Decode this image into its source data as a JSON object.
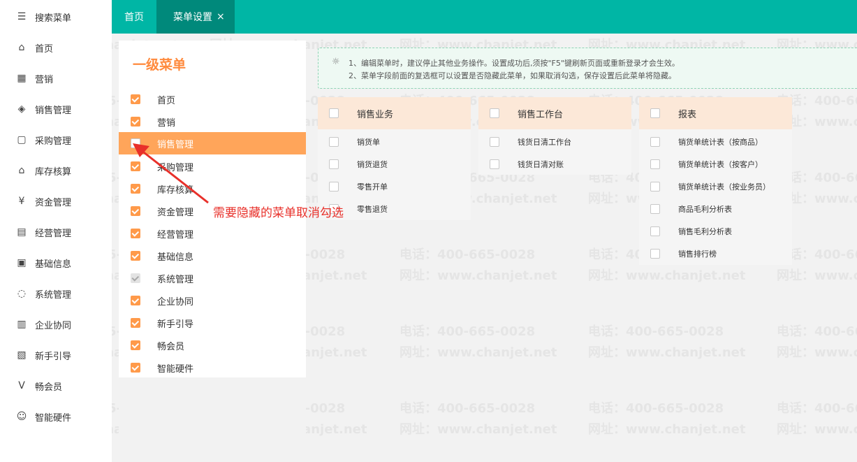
{
  "nav": {
    "items": [
      {
        "label": "搜索菜单",
        "icon": "search-menu-icon",
        "glyph": "☰"
      },
      {
        "label": "首页",
        "icon": "home-icon",
        "glyph": "⌂"
      },
      {
        "label": "营销",
        "icon": "gift-icon",
        "glyph": "▦"
      },
      {
        "label": "销售管理",
        "icon": "sales-icon",
        "glyph": "◈"
      },
      {
        "label": "采购管理",
        "icon": "purchase-bag-icon",
        "glyph": "▢"
      },
      {
        "label": "库存核算",
        "icon": "warehouse-icon",
        "glyph": "⌂"
      },
      {
        "label": "资金管理",
        "icon": "money-icon",
        "glyph": "¥"
      },
      {
        "label": "经营管理",
        "icon": "clipboard-icon",
        "glyph": "▤"
      },
      {
        "label": "基础信息",
        "icon": "id-card-icon",
        "glyph": "▣"
      },
      {
        "label": "系统管理",
        "icon": "system-cycle-icon",
        "glyph": "◌"
      },
      {
        "label": "企业协同",
        "icon": "collaboration-icon",
        "glyph": "▥"
      },
      {
        "label": "新手引导",
        "icon": "guide-icon",
        "glyph": "▧"
      },
      {
        "label": "畅会员",
        "icon": "vip-icon",
        "glyph": "V"
      },
      {
        "label": "智能硬件",
        "icon": "smart-hardware-icon",
        "glyph": "☺"
      }
    ]
  },
  "tabs": {
    "home": "首页",
    "active": "菜单设置",
    "close": "×"
  },
  "first_level": {
    "title": "一级菜单",
    "items": [
      {
        "label": "首页",
        "state": "on"
      },
      {
        "label": "营销",
        "state": "on"
      },
      {
        "label": "销售管理",
        "state": "off",
        "selected": true
      },
      {
        "label": "采购管理",
        "state": "on"
      },
      {
        "label": "库存核算",
        "state": "on"
      },
      {
        "label": "资金管理",
        "state": "on"
      },
      {
        "label": "经营管理",
        "state": "on"
      },
      {
        "label": "基础信息",
        "state": "on"
      },
      {
        "label": "系统管理",
        "state": "dis"
      },
      {
        "label": "企业协同",
        "state": "on"
      },
      {
        "label": "新手引导",
        "state": "on"
      },
      {
        "label": "畅会员",
        "state": "on"
      },
      {
        "label": "智能硬件",
        "state": "on"
      }
    ]
  },
  "notice": {
    "line1": "1、编辑菜单时，建议停止其他业务操作。设置成功后,须按\"F5\"键刷新页面或重新登录才会生效。",
    "line2": "2、菜单字段前面的复选框可以设置是否隐藏此菜单，如果取消勾选，保存设置后此菜单将隐藏。"
  },
  "columns": [
    {
      "title": "销售业务",
      "items": [
        "销货单",
        "销货退货",
        "零售开单",
        "零售退货"
      ]
    },
    {
      "title": "销售工作台",
      "items": [
        "钱货日清工作台",
        "钱货日清对账"
      ]
    },
    {
      "title": "报表",
      "items": [
        "销货单统计表（按商品）",
        "销货单统计表（按客户）",
        "销货单统计表（按业务员）",
        "商品毛利分析表",
        "销售毛利分析表",
        "销售排行榜"
      ]
    }
  ],
  "annotation": {
    "text": "需要隐藏的菜单取消勾选"
  },
  "watermark": {
    "phone": "电话：400-665-0028",
    "site": "网址：www.chanjet.net"
  },
  "colors": {
    "teal": "#00b6a5",
    "teal_dark": "#00897b",
    "orange": "#ff9a4a",
    "selected_row": "#ffa55a",
    "annotation_red": "#e8302a"
  }
}
